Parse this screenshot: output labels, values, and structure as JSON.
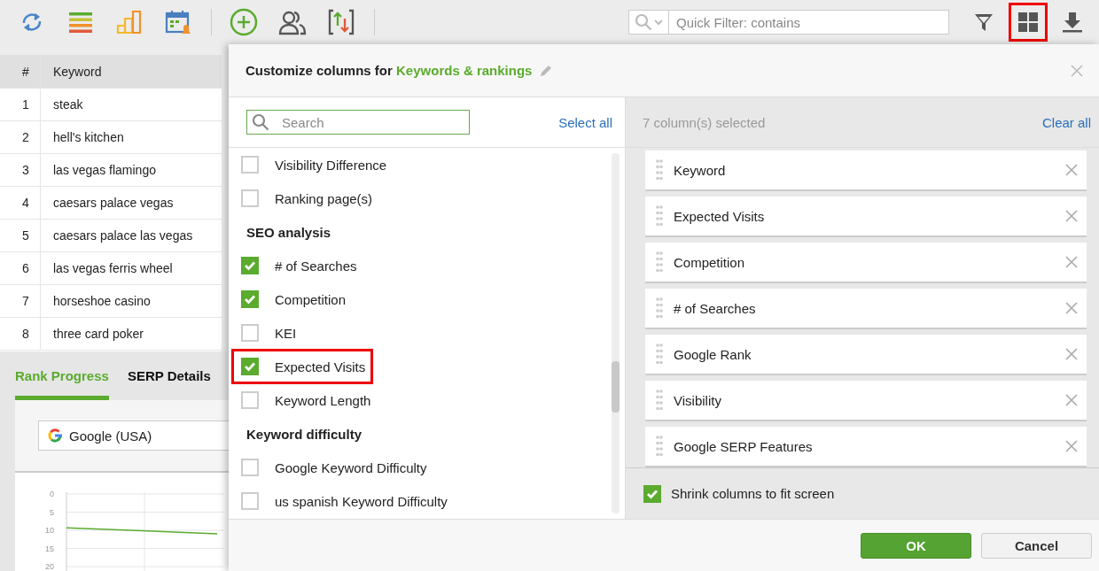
{
  "toolbar": {
    "icons": [
      {
        "kind": "refresh",
        "highlighted": false
      },
      {
        "kind": "bars",
        "highlighted": false
      },
      {
        "kind": "chart",
        "highlighted": false
      },
      {
        "kind": "calendar",
        "highlighted": false
      },
      {
        "kind": "sep"
      },
      {
        "kind": "add",
        "highlighted": false
      },
      {
        "kind": "users",
        "highlighted": false
      },
      {
        "kind": "import",
        "highlighted": false
      },
      {
        "kind": "sep"
      }
    ],
    "quick_filter": {
      "placeholder": "Quick Filter: contains"
    },
    "right_icons": [
      {
        "kind": "filter",
        "highlighted": false
      },
      {
        "kind": "grid",
        "highlighted": true
      },
      {
        "kind": "download",
        "highlighted": false
      }
    ]
  },
  "table": {
    "columns": [
      "#",
      "Keyword"
    ],
    "rows": [
      [
        "1",
        "steak"
      ],
      [
        "2",
        "hell's kitchen"
      ],
      [
        "3",
        "las vegas flamingo"
      ],
      [
        "4",
        "caesars palace vegas"
      ],
      [
        "5",
        "caesars palace las vegas"
      ],
      [
        "6",
        "las vegas ferris wheel"
      ],
      [
        "7",
        "horseshoe casino"
      ],
      [
        "8",
        "three card poker"
      ]
    ]
  },
  "bottom_panel": {
    "tabs": [
      {
        "label": "Rank Progress",
        "selected": true
      },
      {
        "label": "SERP Details",
        "selected": false
      }
    ],
    "engine_select": {
      "value": "Google (USA)"
    },
    "chart_data": {
      "type": "line",
      "grid": true,
      "ylim": [
        20,
        0
      ],
      "yticks": [
        0,
        5,
        10,
        15,
        20
      ],
      "series": [
        {
          "color": "#5aab2e",
          "values": [
            9.3,
            10.1,
            11.0
          ]
        }
      ]
    }
  },
  "dialog": {
    "title": "Customize columns for ",
    "title_link": "Keywords & rankings",
    "search": {
      "placeholder": "Search"
    },
    "select_all": "Select all",
    "items": [
      {
        "kind": "checkbox",
        "label": "Visibility Difference",
        "checked": false,
        "highlighted": false
      },
      {
        "kind": "checkbox",
        "label": "Ranking page(s)",
        "checked": false,
        "highlighted": false
      },
      {
        "kind": "group",
        "label": "SEO analysis"
      },
      {
        "kind": "checkbox",
        "label": "# of Searches",
        "checked": true,
        "highlighted": false
      },
      {
        "kind": "checkbox",
        "label": "Competition",
        "checked": true,
        "highlighted": false
      },
      {
        "kind": "checkbox",
        "label": "KEI",
        "checked": false,
        "highlighted": false
      },
      {
        "kind": "checkbox",
        "label": "Expected Visits",
        "checked": true,
        "highlighted": true
      },
      {
        "kind": "checkbox",
        "label": "Keyword Length",
        "checked": false,
        "highlighted": false
      },
      {
        "kind": "group",
        "label": "Keyword difficulty"
      },
      {
        "kind": "checkbox",
        "label": "Google Keyword Difficulty",
        "checked": false,
        "highlighted": false
      },
      {
        "kind": "checkbox",
        "label": "us spanish Keyword Difficulty",
        "checked": false,
        "highlighted": false
      }
    ],
    "selected_count": "7 column(s) selected",
    "clear_all": "Clear all",
    "selected_columns": [
      "Keyword",
      "Expected Visits",
      "Competition",
      "# of Searches",
      "Google Rank",
      "Visibility",
      "Google SERP Features"
    ],
    "shrink": {
      "label": "Shrink columns to fit screen",
      "checked": true
    },
    "buttons": [
      {
        "kind": "primary",
        "label": "OK"
      },
      {
        "kind": "secondary",
        "label": "Cancel"
      }
    ]
  }
}
